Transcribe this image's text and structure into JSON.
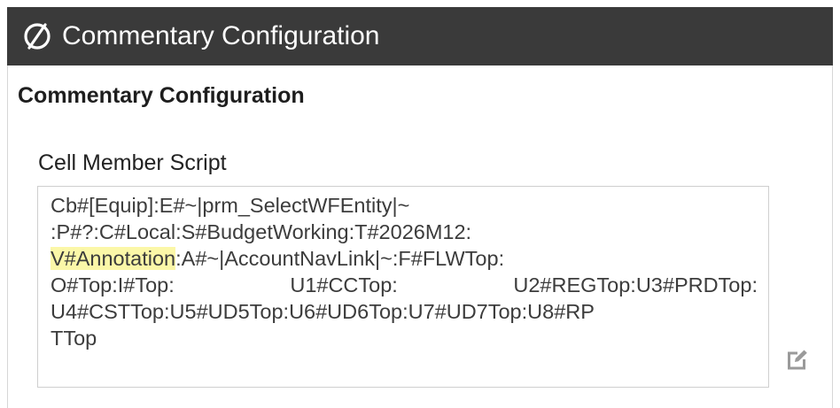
{
  "window": {
    "title": "Commentary Configuration",
    "logo_icon": "onestream-logo-icon"
  },
  "section": {
    "heading": "Commentary Configuration"
  },
  "cell_member_script": {
    "label": "Cell Member Script",
    "lines": {
      "l1": "Cb#[Equip]:E#~|prm_SelectWFEntity|~",
      "l2": ":P#?:C#Local:S#BudgetWorking:T#2026M12:",
      "l3_highlight": "V#Annotation",
      "l3_rest": ":A#~|AccountNavLink|~:F#FLWTop:",
      "l4_a": "O#Top:I#Top:",
      "l4_b": "U1#CCTop:",
      "l4_c": "U2#REGTop:U3#PRDTop:",
      "l5": "U4#CSTTop:U5#UD5Top:U6#UD6Top:U7#UD7Top:U8#RP",
      "l6": "TTop"
    },
    "highlight_color": "#fbf7a8",
    "edit_icon": "edit-icon"
  },
  "colors": {
    "title_bar": "#3a3a3a",
    "title_text": "#ffffff",
    "border": "#cfcfcf"
  }
}
